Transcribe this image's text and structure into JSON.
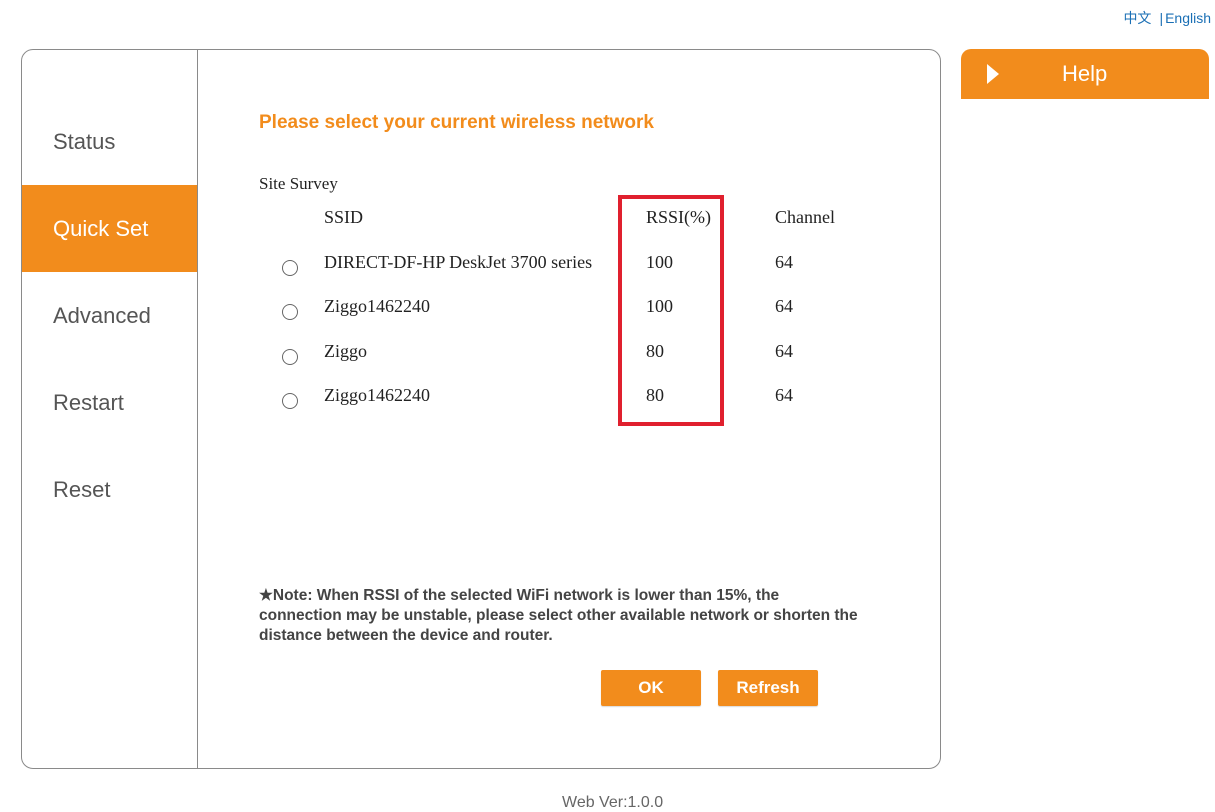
{
  "lang": {
    "zh": "中文",
    "sep": "|",
    "en": "English"
  },
  "nav": {
    "items": [
      {
        "label": "Status"
      },
      {
        "label": "Quick Set"
      },
      {
        "label": "Advanced"
      },
      {
        "label": "Restart"
      },
      {
        "label": "Reset"
      }
    ],
    "active": "Quick Set"
  },
  "main": {
    "heading": "Please select your current wireless network",
    "survey_label": "Site Survey",
    "columns": {
      "ssid": "SSID",
      "rssi": "RSSI(%)",
      "channel": "Channel"
    },
    "networks": [
      {
        "ssid": "DIRECT-DF-HP DeskJet 3700 series",
        "rssi": "100",
        "channel": "64"
      },
      {
        "ssid": "Ziggo1462240",
        "rssi": "100",
        "channel": "64"
      },
      {
        "ssid": "Ziggo",
        "rssi": "80",
        "channel": "64"
      },
      {
        "ssid": "Ziggo1462240",
        "rssi": "80",
        "channel": "64"
      }
    ],
    "note": "★Note: When RSSI of the selected WiFi network is lower than 15%, the connection may be unstable, please select other available network or shorten the distance between the device and router.",
    "ok_label": "OK",
    "refresh_label": "Refresh"
  },
  "help": {
    "label": "Help"
  },
  "footer": {
    "version": "Web Ver:1.0.0"
  },
  "colors": {
    "accent": "#f28c1c",
    "highlight": "#e0202e",
    "link": "#1a6fb5"
  }
}
